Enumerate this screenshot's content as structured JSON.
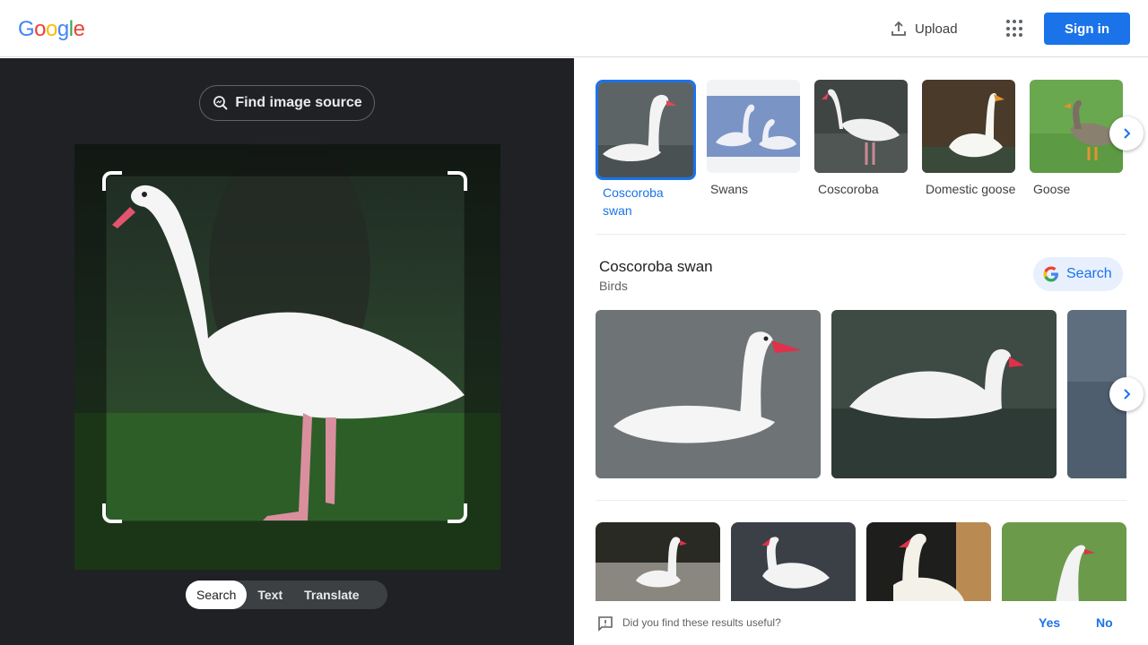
{
  "header": {
    "logo_letters": [
      {
        "ch": "G",
        "color": "#4285F4"
      },
      {
        "ch": "o",
        "color": "#EA4335"
      },
      {
        "ch": "o",
        "color": "#FBBC05"
      },
      {
        "ch": "g",
        "color": "#4285F4"
      },
      {
        "ch": "l",
        "color": "#34A853"
      },
      {
        "ch": "e",
        "color": "#EA4335"
      }
    ],
    "upload_label": "Upload",
    "apps_icon": "apps-grid-icon",
    "signin_label": "Sign in"
  },
  "left": {
    "find_source_label": "Find image source",
    "modes": [
      "Search",
      "Text",
      "Translate"
    ],
    "active_mode": "Search"
  },
  "right": {
    "chips": [
      {
        "label": "Coscoroba swan",
        "selected": true
      },
      {
        "label": "Swans",
        "selected": false
      },
      {
        "label": "Coscoroba",
        "selected": false
      },
      {
        "label": "Domestic goose",
        "selected": false
      },
      {
        "label": "Goose",
        "selected": false
      }
    ],
    "entity": {
      "title": "Coscoroba swan",
      "subtitle": "Birds",
      "search_label": "Search"
    },
    "feedback": {
      "question": "Did you find these results useful?",
      "yes": "Yes",
      "no": "No"
    }
  },
  "colors": {
    "accent": "#1a73e8",
    "dark_panel": "#202124"
  }
}
